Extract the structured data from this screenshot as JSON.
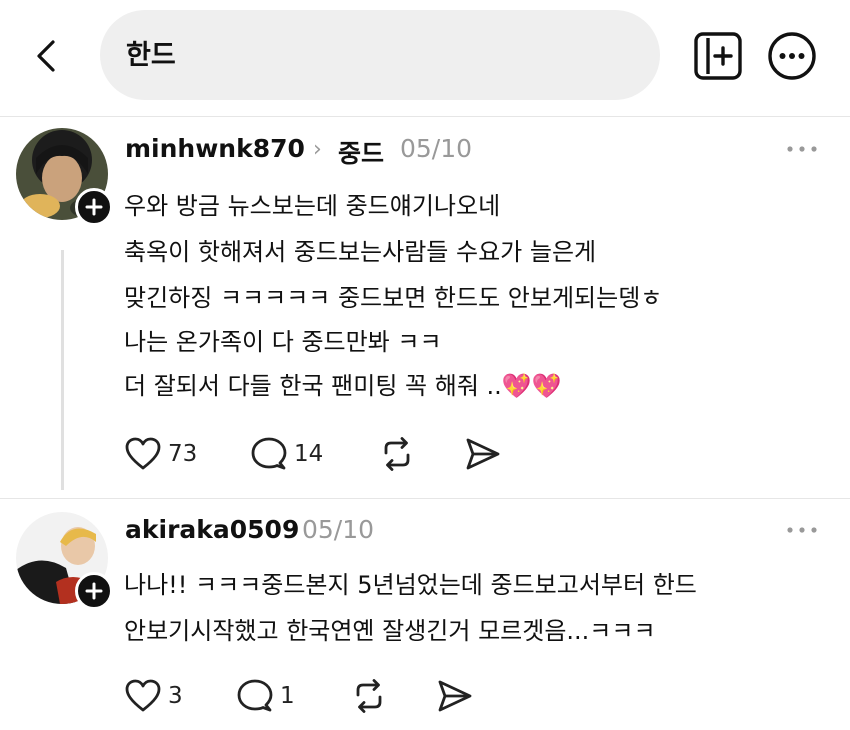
{
  "header": {
    "search_query": "한드"
  },
  "posts": [
    {
      "username": "minhwnk870",
      "community": "중드",
      "date": "05/10",
      "lines": [
        "우와 방금 뉴스보는데 중드얘기나오네",
        "축옥이 핫해져서 중드보는사람들 수요가 늘은게",
        "맞긴하징 ㅋㅋㅋㅋㅋ 중드보면 한드도 안보게되는뎅ㅎ",
        "나는 온가족이 다 중드만봐 ㅋㅋ",
        "더 잘되서 다들 한국 팬미팅 꼭 해줘 .."
      ],
      "emoji": "💖💖",
      "likes": "73",
      "replies": "14"
    },
    {
      "username": "akiraka0509",
      "date": "05/10",
      "lines": [
        "나나!! ㅋㅋㅋ중드본지 5년넘었는데 중드보고서부터 한드",
        "안보기시작했고 한국연옌 잘생긴거 모르겟음...ㅋㅋㅋ"
      ],
      "likes": "3",
      "replies": "1"
    }
  ]
}
